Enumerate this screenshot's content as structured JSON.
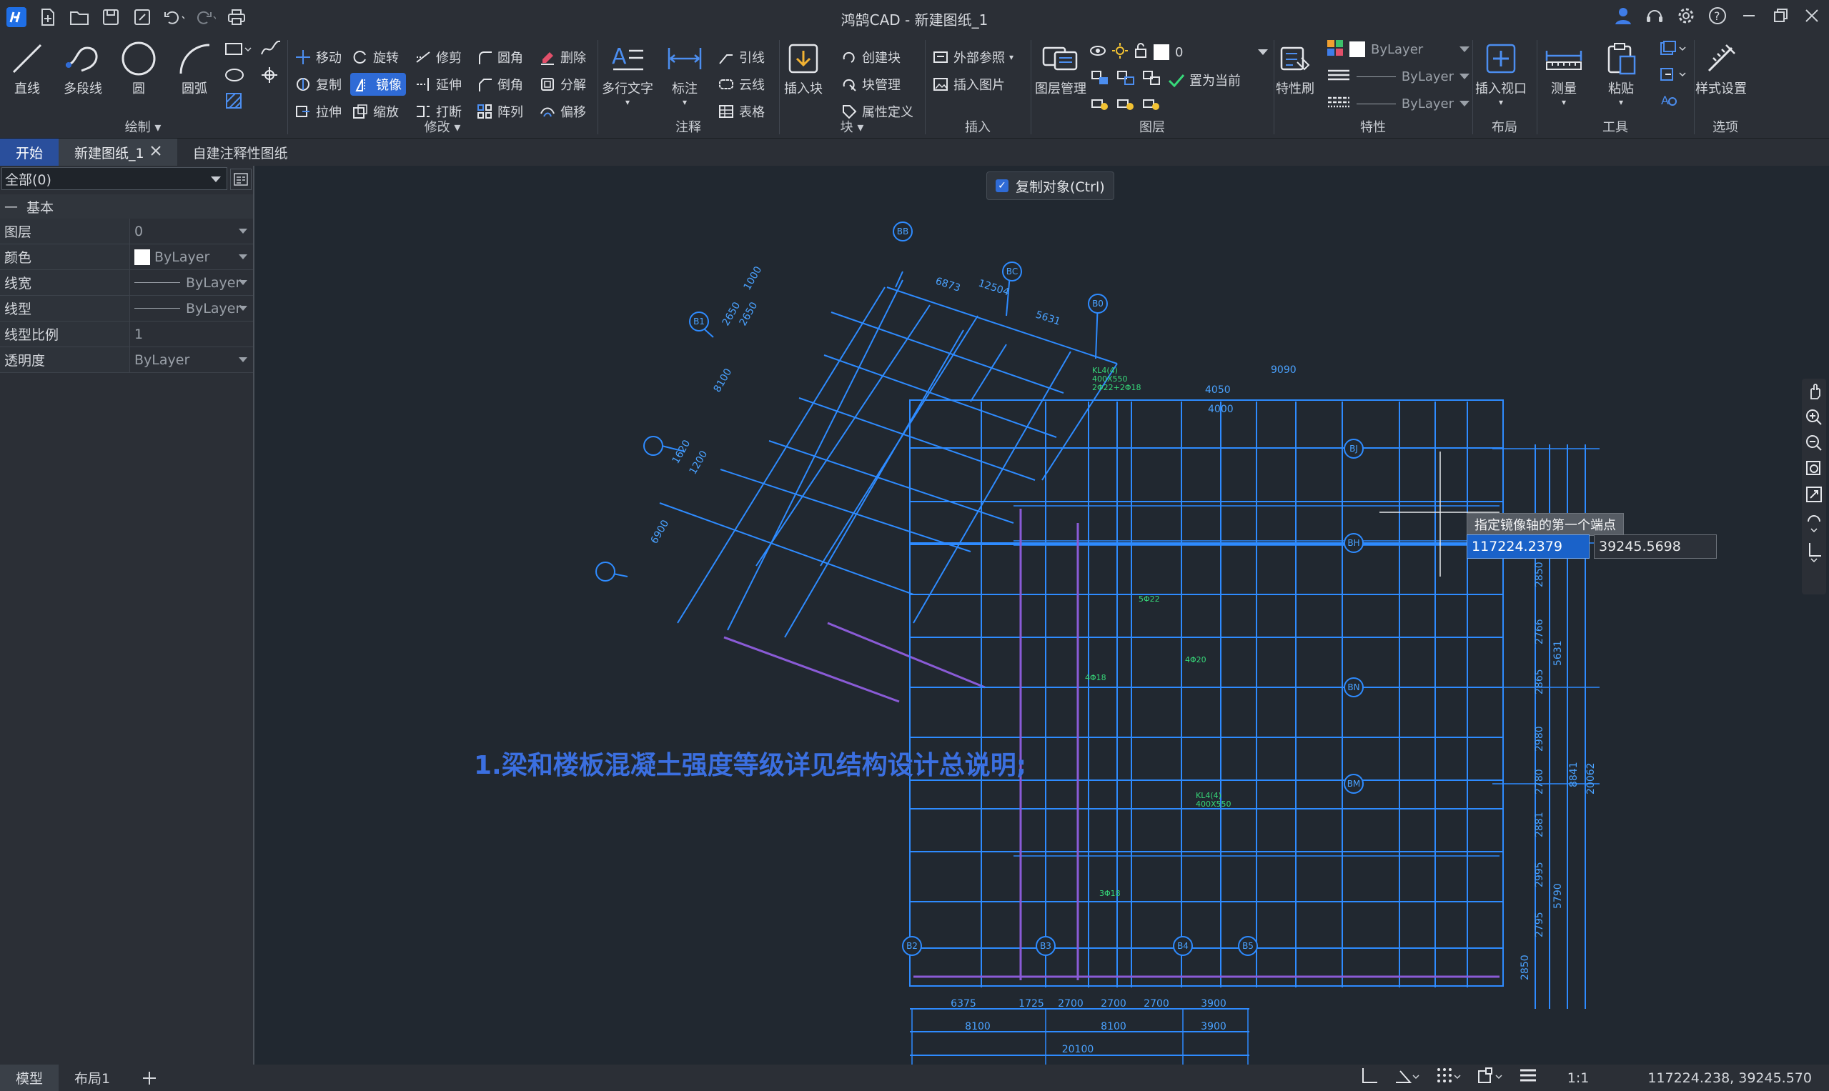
{
  "app": {
    "title": "鸿鹄CAD - 新建图纸_1"
  },
  "ribbon": {
    "draw": {
      "label": "绘制",
      "line": "直线",
      "polyline": "多段线",
      "circle": "圆",
      "arc": "圆弧"
    },
    "modify": {
      "label": "修改",
      "move": "移动",
      "rotate": "旋转",
      "trim": "修剪",
      "fillet": "圆角",
      "erase": "删除",
      "copy": "复制",
      "mirror": "镜像",
      "extend": "延伸",
      "chamfer": "倒角",
      "explode": "分解",
      "stretch": "拉伸",
      "scale": "缩放",
      "break": "打断",
      "array": "阵列",
      "offset": "偏移"
    },
    "annotation": {
      "label": "注释",
      "mtext": "多行文字",
      "dim": "标注",
      "leader": "引线",
      "revcloud": "云线",
      "table": "表格"
    },
    "block": {
      "label": "块",
      "insert": "插入块",
      "create": "创建块",
      "manage": "块管理",
      "attdef": "属性定义"
    },
    "insert": {
      "label": "插入",
      "xref": "外部参照",
      "image": "插入图片"
    },
    "layer": {
      "label": "图层",
      "manager": "图层管理",
      "current_layer": "0",
      "set_current": "置为当前"
    },
    "properties": {
      "label": "特性",
      "matchprop": "特性刷",
      "color": "ByLayer",
      "linetype": "ByLayer",
      "lineweight": "ByLayer"
    },
    "layout": {
      "label": "布局",
      "viewport": "插入视口"
    },
    "tools": {
      "label": "工具",
      "measure": "测量",
      "paste": "粘贴"
    },
    "options": {
      "label": "选项",
      "style": "样式设置"
    }
  },
  "tabs": [
    "开始",
    "新建图纸_1",
    "自建注释性图纸"
  ],
  "panel": {
    "selector": "全部(0)",
    "group": "基本",
    "props": [
      {
        "key": "图层",
        "value": "0"
      },
      {
        "key": "颜色",
        "value": "ByLayer"
      },
      {
        "key": "线宽",
        "value": "ByLayer"
      },
      {
        "key": "线型",
        "value": "ByLayer"
      },
      {
        "key": "线型比例",
        "value": "1"
      },
      {
        "key": "透明度",
        "value": "ByLayer"
      }
    ]
  },
  "canvas": {
    "copy_toggle": "复制对象(Ctrl)",
    "prompt": "指定镜像轴的第一个端点",
    "input_x": "117224.2379",
    "input_y": "39245.5698",
    "note": "1.梁和楼板混凝土强度等级详见结构设计总说明;",
    "axis_bubbles": [
      "B2",
      "B3",
      "B4",
      "B5",
      "BJ",
      "BH",
      "BN",
      "BM",
      "B1",
      "B0",
      "BC",
      "BB"
    ],
    "dims_bottom": [
      "6375",
      "1725",
      "2700",
      "2700",
      "2700",
      "3900",
      "8100",
      "8100",
      "3900",
      "20100"
    ],
    "dims_right": [
      "2850",
      "2766",
      "2865",
      "2980",
      "2780",
      "2881",
      "2995",
      "2795",
      "5631",
      "8841",
      "20062",
      "5790",
      "2850"
    ],
    "dims_top": [
      "4050",
      "4000",
      "9090",
      "12504",
      "6873",
      "5631"
    ],
    "dims_left": [
      "2650",
      "1000",
      "8100",
      "2650",
      "1200",
      "1620",
      "6900"
    ],
    "labels": [
      "KL4(4)",
      "400X550",
      "4Φ18",
      "2Φ22+2Φ18",
      "5Φ22",
      "4Φ20",
      "3Φ18",
      "4Φ18"
    ]
  },
  "status": {
    "tabs": [
      "模型",
      "布局1"
    ],
    "scale": "1:1",
    "coords": "117224.238, 39245.570"
  },
  "colors": {
    "accent": "#2f6bd6",
    "drawing": "#2e8bff",
    "text_green": "#37d97a",
    "axis_magenta": "#8a5bd6"
  }
}
